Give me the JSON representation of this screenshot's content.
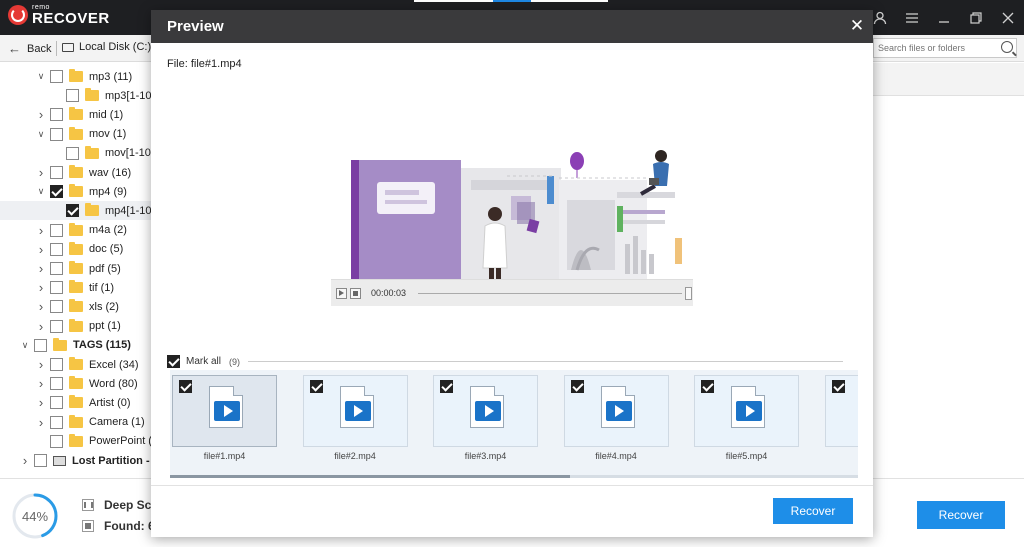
{
  "app": {
    "logo_sub": "remo",
    "logo_main": "RECOVER"
  },
  "window_controls": [
    "user-icon",
    "menu-icon",
    "minimize-icon",
    "restore-icon",
    "close-icon"
  ],
  "nav": {
    "back_label": "Back",
    "location_label": "Local Disk (C:)",
    "search_placeholder": "Search files or folders"
  },
  "tree": [
    {
      "label": "mp3 (11)",
      "chevron": "down",
      "checked": false,
      "depth": 1,
      "icon": "folder"
    },
    {
      "label": "mp3[1-10",
      "chevron": "",
      "checked": false,
      "depth": 2,
      "icon": "folder"
    },
    {
      "label": "mid (1)",
      "chevron": "right",
      "checked": false,
      "depth": 1,
      "icon": "folder"
    },
    {
      "label": "mov (1)",
      "chevron": "down",
      "checked": false,
      "depth": 1,
      "icon": "folder"
    },
    {
      "label": "mov[1-10",
      "chevron": "",
      "checked": false,
      "depth": 2,
      "icon": "folder"
    },
    {
      "label": "wav (16)",
      "chevron": "right",
      "checked": false,
      "depth": 1,
      "icon": "folder"
    },
    {
      "label": "mp4 (9)",
      "chevron": "down",
      "checked": true,
      "depth": 1,
      "icon": "folder"
    },
    {
      "label": "mp4[1-10",
      "chevron": "",
      "checked": true,
      "depth": 2,
      "icon": "folder",
      "selected": true
    },
    {
      "label": "m4a (2)",
      "chevron": "right",
      "checked": false,
      "depth": 1,
      "icon": "folder"
    },
    {
      "label": "doc (5)",
      "chevron": "right",
      "checked": false,
      "depth": 1,
      "icon": "folder"
    },
    {
      "label": "pdf (5)",
      "chevron": "right",
      "checked": false,
      "depth": 1,
      "icon": "folder"
    },
    {
      "label": "tif (1)",
      "chevron": "right",
      "checked": false,
      "depth": 1,
      "icon": "folder"
    },
    {
      "label": "xls (2)",
      "chevron": "right",
      "checked": false,
      "depth": 1,
      "icon": "folder"
    },
    {
      "label": "ppt (1)",
      "chevron": "right",
      "checked": false,
      "depth": 1,
      "icon": "folder"
    },
    {
      "label": "TAGS (115)",
      "chevron": "down",
      "checked": false,
      "depth": 0,
      "icon": "folder",
      "bold": true
    },
    {
      "label": "Excel (34)",
      "chevron": "right",
      "checked": false,
      "depth": 1,
      "icon": "folder"
    },
    {
      "label": "Word (80)",
      "chevron": "right",
      "checked": false,
      "depth": 1,
      "icon": "folder"
    },
    {
      "label": "Artist (0)",
      "chevron": "right",
      "checked": false,
      "depth": 1,
      "icon": "folder"
    },
    {
      "label": "Camera (1)",
      "chevron": "right",
      "checked": false,
      "depth": 1,
      "icon": "folder"
    },
    {
      "label": "PowerPoint (",
      "chevron": "",
      "checked": false,
      "depth": 1,
      "icon": "folder"
    },
    {
      "label": "Lost Partition -",
      "chevron": "right",
      "checked": false,
      "depth": 0,
      "icon": "disk",
      "bold": true
    }
  ],
  "status": {
    "progress_percent": 44,
    "progress_label": "44%",
    "scan_label": "Deep Sc",
    "found_label": "Found: 6"
  },
  "app_recover_label": "Recover",
  "preview": {
    "title": "Preview",
    "file_label": "File: file#1.mp4",
    "player_time": "00:00:03",
    "mark_all_label": "Mark all",
    "mark_all_count": "(9)",
    "recover_label": "Recover",
    "thumbnails": [
      {
        "name": "file#1.mp4",
        "checked": true,
        "selected": true
      },
      {
        "name": "file#2.mp4",
        "checked": true
      },
      {
        "name": "file#3.mp4",
        "checked": true
      },
      {
        "name": "file#4.mp4",
        "checked": true
      },
      {
        "name": "file#5.mp4",
        "checked": true
      },
      {
        "name": "",
        "checked": true
      }
    ]
  },
  "colors": {
    "accent": "#1e8ee8",
    "titlebar": "#1e1f22",
    "dialog_header": "#3a3a3c",
    "folder": "#f6c544",
    "progress_ring": "#2a9be6"
  }
}
